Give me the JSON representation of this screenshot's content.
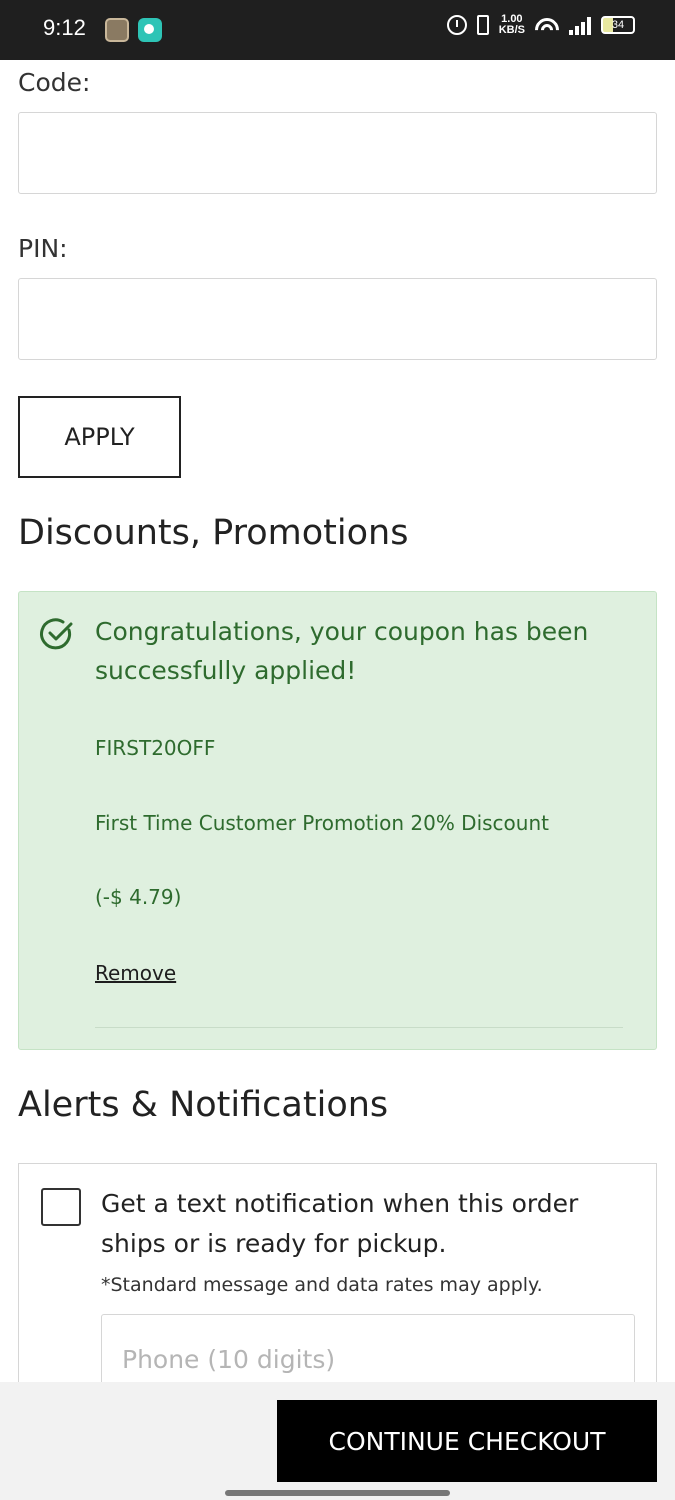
{
  "status_bar": {
    "time": "9:12",
    "speed_top": "1.00",
    "speed_bottom": "KB/S",
    "battery": "34"
  },
  "form": {
    "code_label": "Code:",
    "code_value": "",
    "pin_label": "PIN:",
    "pin_value": "",
    "apply_label": "APPLY"
  },
  "discounts": {
    "title": "Discounts, Promotions",
    "success_message": "Congratulations, your coupon has been successfully applied!",
    "coupon_code": "FIRST20OFF",
    "description": "First Time Customer Promotion 20% Discount",
    "amount": "(-$ 4.79)",
    "remove_label": "Remove",
    "colors": {
      "background": "#dff0df",
      "text": "#2e6b2e"
    }
  },
  "alerts": {
    "title": "Alerts & Notifications",
    "notify_text": "Get a text notification when this order ships or is ready for pickup.",
    "rates_note": "*Standard message and data rates may apply.",
    "phone_placeholder": "Phone (10 digits)",
    "checkbox_checked": false
  },
  "footer": {
    "continue_label": "CONTINUE CHECKOUT"
  }
}
